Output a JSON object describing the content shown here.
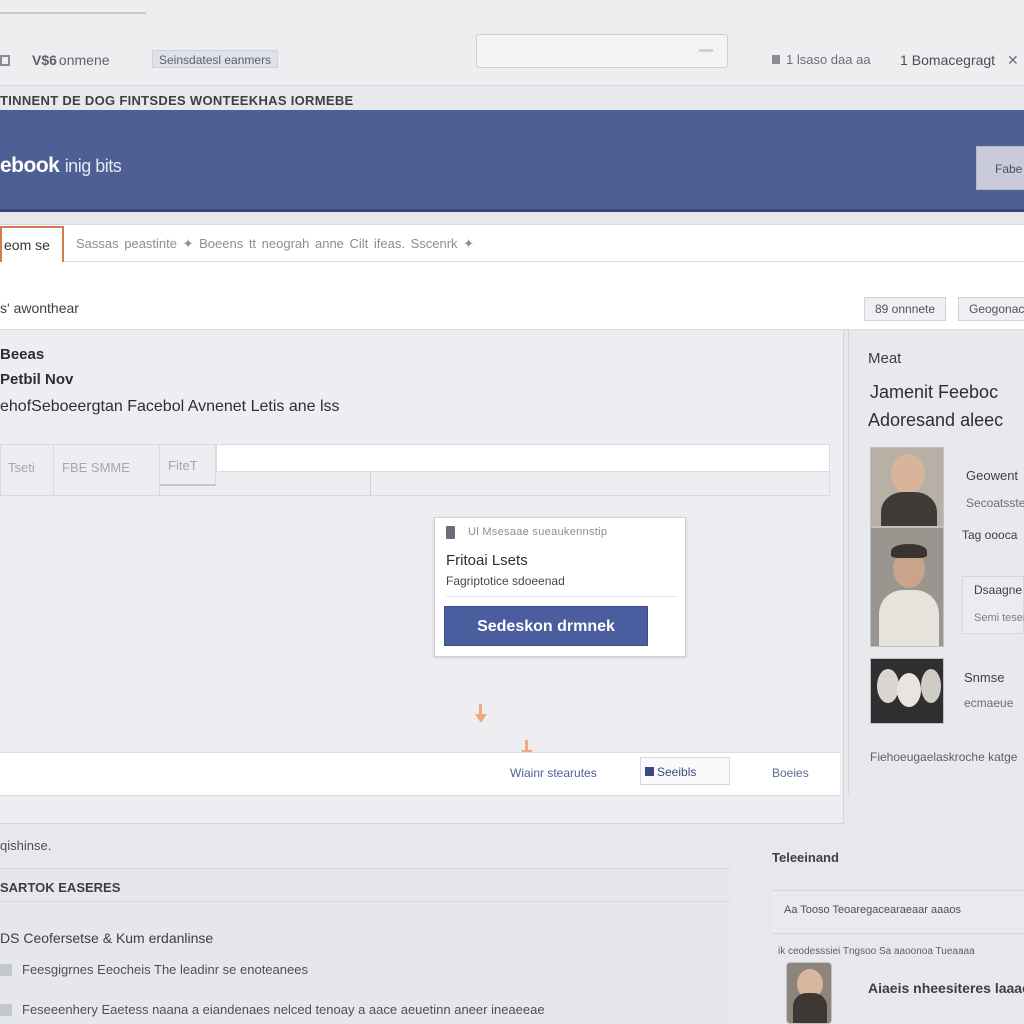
{
  "topbar": {
    "left_title": "V$6",
    "left_title_suffix": "onmene",
    "chip": "Seinsdatesl eanmers",
    "right_text": "1 lsaso daa aa",
    "right_label": "Bomacegragt"
  },
  "breadcrumb": "TINNENT DE DOG FINTSDES WONTEEKHAS IORMEBE",
  "header": {
    "logo_bold": "ebook",
    "logo_light": "inig bits",
    "button_label": "Fabe"
  },
  "tabs": {
    "active": "eom se",
    "links": "Sassas peastinte  ✦  Boeens  tt   neograh anne   Cilt ifeas.   Sscenrk  ✦"
  },
  "panel": {
    "title": "s' awonthear",
    "button_1": "89 onnnete",
    "button_2": "Geogonacrts"
  },
  "main": {
    "line_1": "Beeas",
    "line_2": "Petbil Nov",
    "line_3": "ehofSeboeergtan Facebol Avnenet Letis ane lss",
    "filters": [
      "Tseti",
      "FBE SMME",
      "FiteT"
    ]
  },
  "dialog": {
    "top_text": "Ul Msesaae sueaukennstip",
    "title": "Fritoai Lsets",
    "subtitle": "Fagriptotice sdoeenad",
    "primary_button": "Sedeskon drmnek"
  },
  "footer": {
    "link_1": "Wiainr stearutes",
    "button": "Seeibls",
    "link_2": "Boeies"
  },
  "sidebar": {
    "heading": "Meat",
    "title_line_1": "Jamenit Feeboc",
    "title_line_2": "Adoresand aleec",
    "person_1_name": "Geowent",
    "person_1_sub": "Secoatsste",
    "person_1_meta": "Tag oooca",
    "card_title": "Dsaagne",
    "card_sub": "Semi tesere",
    "person_3_name": "Snmse",
    "person_3_sub": "ecmaeue",
    "caption": "Fiehoeugaelaskroche katge"
  },
  "lower": {
    "note": "qishinse.",
    "section_title": "SARTOK EASERES",
    "row_1": "DS Ceofersetse &  Kum erdanlinse",
    "row_2": "Feesgigrnes  Eeocheis The leadinr se enoteanees",
    "row_3": "Feseeenhery  Eaetess naana a eiandenaes nelced tenoay a aace aeuetinn aneer ineaeeae",
    "right_title": "Teleeinand",
    "right_row_1": "Aa   Tooso      Teoaregacearaeaar aaaos",
    "right_row_2": "ik ceodesssiei  Tngsoo   Sa aaoonoa   Tueaaaa",
    "right_row_3": "Aiaeis nheesiteres laaae"
  }
}
